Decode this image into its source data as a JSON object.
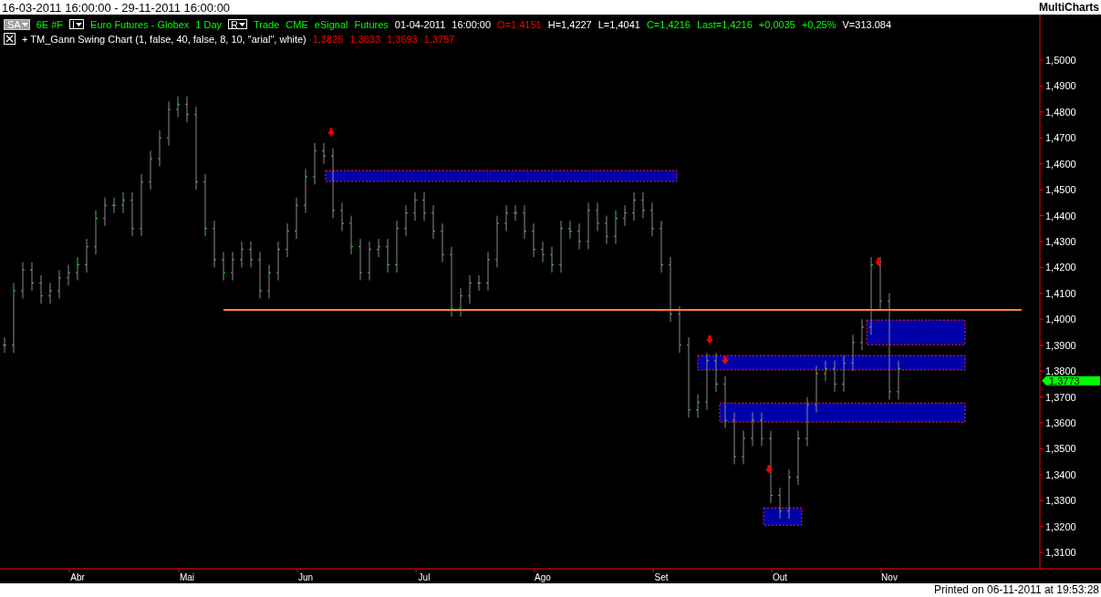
{
  "date_range": "16-03-2011 16:00:00 - 29-11-2011 16:00:00",
  "brand": "MultiCharts",
  "symbol_row": [
    {
      "kind": "menu",
      "text": "SA"
    },
    {
      "kind": "label",
      "text": "6E #F",
      "color": "#00ff00"
    },
    {
      "kind": "toggle",
      "text": "I"
    },
    {
      "kind": "label",
      "text": "Euro Futures - Globex",
      "color": "#00ff00"
    },
    {
      "kind": "label",
      "text": "1 Day",
      "color": "#00ff00"
    },
    {
      "kind": "toggle",
      "text": "R"
    },
    {
      "kind": "label",
      "text": "Trade",
      "color": "#00ff00"
    },
    {
      "kind": "label",
      "text": "CME",
      "color": "#00ff00"
    },
    {
      "kind": "label",
      "text": "eSignal",
      "color": "#00ff00"
    },
    {
      "kind": "label",
      "text": "Futures",
      "color": "#00ff00"
    },
    {
      "kind": "label",
      "text": "01-04-2011",
      "color": "#ffffff"
    },
    {
      "kind": "label",
      "text": "16:00:00",
      "color": "#ffffff"
    },
    {
      "kind": "label",
      "text": "O=1,4151",
      "color": "#ff0000"
    },
    {
      "kind": "label",
      "text": "H=1,4227",
      "color": "#ffffff"
    },
    {
      "kind": "label",
      "text": "L=1,4041",
      "color": "#ffffff"
    },
    {
      "kind": "label",
      "text": "C=1,4216",
      "color": "#00ff00"
    },
    {
      "kind": "label",
      "text": "Last=1,4216",
      "color": "#00ff00"
    },
    {
      "kind": "label",
      "text": "+0,0035",
      "color": "#00ff00"
    },
    {
      "kind": "label",
      "text": "+0,25%",
      "color": "#00ff00"
    },
    {
      "kind": "label",
      "text": "V=313.084",
      "color": "#ffffff"
    }
  ],
  "indicator_row": [
    {
      "kind": "close"
    },
    {
      "kind": "label",
      "text": "+ TM_Gann Swing Chart  (1,  false,  40,  false,  8,  10,  \"arial\",  white)",
      "color": "#ffffff"
    },
    {
      "kind": "label",
      "text": "1,3825",
      "color": "#ff0000"
    },
    {
      "kind": "label",
      "text": "1,3633",
      "color": "#ff0000"
    },
    {
      "kind": "label",
      "text": "1,3693",
      "color": "#ff0000"
    },
    {
      "kind": "label",
      "text": "1,3757",
      "color": "#ff0000"
    }
  ],
  "price_axis": [
    "1,5000",
    "1,4900",
    "1,4800",
    "1,4700",
    "1,4600",
    "1,4500",
    "1,4400",
    "1,4300",
    "1,4200",
    "1,4100",
    "1,4000",
    "1,3900",
    "1,3800",
    "1,3700",
    "1,3600",
    "1,3500",
    "1,3400",
    "1,3300",
    "1,3200",
    "1,3100"
  ],
  "last_price": "1,3773",
  "time_axis": [
    "Abr",
    "Mai",
    "Jun",
    "Jul",
    "Ago",
    "Set",
    "Out",
    "Nov"
  ],
  "footer": "Printed on 06-11-2011 at 19:53:28"
}
